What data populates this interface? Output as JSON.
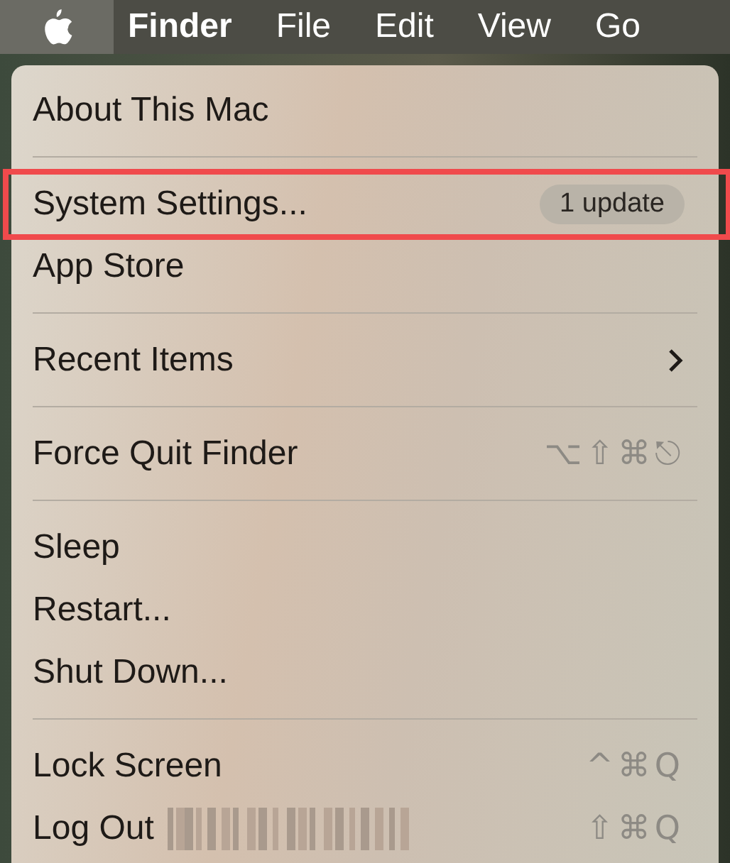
{
  "menu_bar": {
    "items": [
      {
        "label": "Finder",
        "bold": true
      },
      {
        "label": "File",
        "bold": false
      },
      {
        "label": "Edit",
        "bold": false
      },
      {
        "label": "View",
        "bold": false
      },
      {
        "label": "Go",
        "bold": false
      }
    ],
    "apple_selected": true
  },
  "menu": {
    "items": [
      {
        "kind": "item",
        "label": "About This Mac",
        "outlined": false
      },
      {
        "kind": "separator"
      },
      {
        "kind": "item",
        "label": "System Settings...",
        "badge": "1 update",
        "outlined": true
      },
      {
        "kind": "item",
        "label": "App Store",
        "outlined": false
      },
      {
        "kind": "separator"
      },
      {
        "kind": "item",
        "label": "Recent Items",
        "submenu": true,
        "outlined": false
      },
      {
        "kind": "separator"
      },
      {
        "kind": "item",
        "label": "Force Quit Finder",
        "shortcut": "⌥⇧⌘⎋",
        "outlined": false
      },
      {
        "kind": "separator"
      },
      {
        "kind": "item",
        "label": "Sleep",
        "outlined": false
      },
      {
        "kind": "item",
        "label": "Restart...",
        "outlined": false
      },
      {
        "kind": "item",
        "label": "Shut Down...",
        "outlined": false
      },
      {
        "kind": "separator"
      },
      {
        "kind": "item",
        "label": "Lock Screen",
        "shortcut": "^⌘Q",
        "outlined": false
      },
      {
        "kind": "item",
        "label": "Log Out",
        "redacted": true,
        "shortcut": "⇧⌘Q",
        "outlined": false
      }
    ]
  }
}
